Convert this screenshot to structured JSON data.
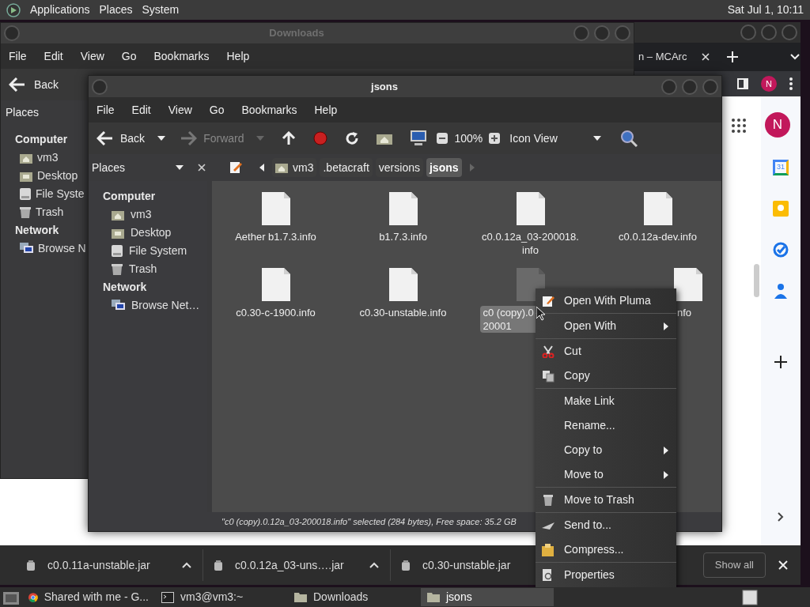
{
  "top_panel": {
    "menus": [
      "Applications",
      "Places",
      "System"
    ],
    "clock": "Sat Jul 1, 10:11"
  },
  "browser": {
    "tab_title": "n – MCArc",
    "avatar": "N",
    "side_avatar": "N",
    "calendar_day": "31",
    "downloads": [
      {
        "name": "c0.0.11a-unstable.jar",
        "caret": true
      },
      {
        "name": "c0.0.12a_03-uns….jar",
        "caret": true
      },
      {
        "name": "c0.30-unstable.jar"
      }
    ],
    "show_all": "Show all"
  },
  "downloads_window": {
    "title": "Downloads",
    "menu": [
      "File",
      "Edit",
      "View",
      "Go",
      "Bookmarks",
      "Help"
    ],
    "back": "Back",
    "places": "Places",
    "sections": [
      {
        "heading": "Computer",
        "items": [
          {
            "label": "vm3",
            "kind": "home"
          },
          {
            "label": "Desktop",
            "kind": "desktop"
          },
          {
            "label": "File Syste",
            "kind": "drive"
          },
          {
            "label": "Trash",
            "kind": "trash"
          }
        ]
      },
      {
        "heading": "Network",
        "items": [
          {
            "label": "Browse N",
            "kind": "network"
          }
        ]
      }
    ]
  },
  "jsons_window": {
    "title": "jsons",
    "menu": [
      "File",
      "Edit",
      "View",
      "Go",
      "Bookmarks",
      "Help"
    ],
    "toolbar": {
      "back": "Back",
      "forward": "Forward",
      "zoom": "100%",
      "view": "Icon View"
    },
    "places": "Places",
    "sections": [
      {
        "heading": "Computer",
        "items": [
          {
            "label": "vm3",
            "kind": "home"
          },
          {
            "label": "Desktop",
            "kind": "desktop"
          },
          {
            "label": "File System",
            "kind": "drive"
          },
          {
            "label": "Trash",
            "kind": "trash"
          }
        ]
      },
      {
        "heading": "Network",
        "items": [
          {
            "label": "Browse Net…",
            "kind": "network"
          }
        ]
      }
    ],
    "path": [
      {
        "label": "vm3",
        "home": true,
        "selected": false
      },
      {
        "label": ".betacraft",
        "home": false,
        "selected": false
      },
      {
        "label": "versions",
        "home": false,
        "selected": false
      },
      {
        "label": "jsons",
        "home": false,
        "selected": true
      }
    ],
    "files": [
      {
        "lines": [
          "Aether b1.7.3.info"
        ],
        "selected": false
      },
      {
        "lines": [
          "b1.7.3.info"
        ],
        "selected": false
      },
      {
        "lines": [
          "c0.0.12a_03-200018.",
          "info"
        ],
        "selected": false
      },
      {
        "lines": [
          "c0.0.12a-dev.info"
        ],
        "selected": false
      },
      {
        "lines": [
          "c0.30-c-1900.info"
        ],
        "selected": false
      },
      {
        "lines": [
          "c0.30-unstable.info"
        ],
        "selected": false
      },
      {
        "lines": [
          "c0 (copy).0",
          "20001"
        ],
        "selected": true
      },
      {
        "lines": [
          "nfo"
        ],
        "selected": false
      }
    ],
    "status": "\"c0 (copy).0.12a_03-200018.info\" selected (284 bytes), Free space: 35.2 GB"
  },
  "context_menu": [
    [
      {
        "label": "Open With Pluma",
        "kind": "pluma",
        "submenu": false
      }
    ],
    [
      {
        "label": "Open With",
        "kind": "plain",
        "submenu": true
      }
    ],
    [
      {
        "label": "Cut",
        "kind": "scissors",
        "submenu": false
      },
      {
        "label": "Copy",
        "kind": "copy",
        "submenu": false
      }
    ],
    [
      {
        "label": "Make Link",
        "kind": "plain",
        "submenu": false
      },
      {
        "label": "Rename...",
        "kind": "plain",
        "submenu": false
      },
      {
        "label": "Copy to",
        "kind": "plain",
        "submenu": true
      },
      {
        "label": "Move to",
        "kind": "plain",
        "submenu": true
      }
    ],
    [
      {
        "label": "Move to Trash",
        "kind": "trash",
        "submenu": false
      }
    ],
    [
      {
        "label": "Send to...",
        "kind": "send",
        "submenu": false
      },
      {
        "label": "Compress...",
        "kind": "package",
        "submenu": false
      }
    ],
    [
      {
        "label": "Properties",
        "kind": "properties",
        "submenu": false
      }
    ]
  ],
  "taskbar": [
    {
      "label": "Shared with me - G...",
      "kind": "browser",
      "selected": false
    },
    {
      "label": "vm3@vm3:~",
      "kind": "terminal",
      "selected": false
    },
    {
      "label": "Downloads",
      "kind": "folder",
      "selected": false
    },
    {
      "label": "jsons",
      "kind": "folder",
      "selected": true
    }
  ]
}
